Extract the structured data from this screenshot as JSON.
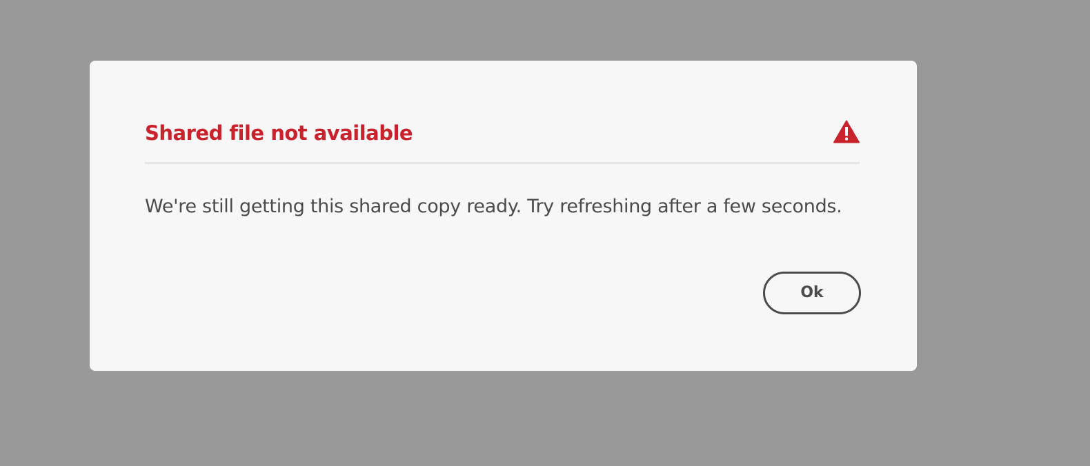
{
  "dialog": {
    "title": "Shared file not available",
    "icon": "alert-triangle-icon",
    "message": "We're still getting this shared copy ready. Try refreshing after a few seconds.",
    "ok_label": "Ok"
  },
  "colors": {
    "overlay": "#999999",
    "dialog_background": "#f7f7f7",
    "title": "#c8232c",
    "icon": "#c8232c",
    "text": "#4b4b4b",
    "divider": "#e4e4e4"
  }
}
